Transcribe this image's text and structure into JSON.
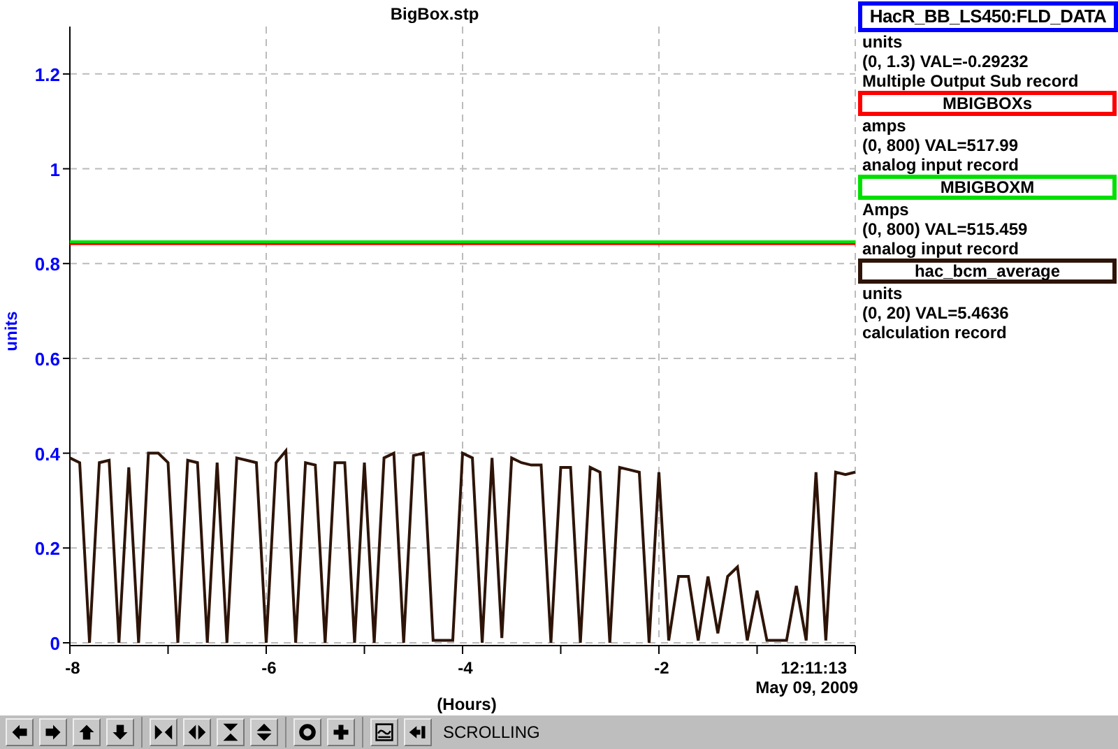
{
  "plot": {
    "title": "BigBox.stp",
    "timestamp_time": "12:11:13",
    "timestamp_date": "May 09, 2009",
    "chart_data": {
      "type": "line",
      "grid": true,
      "xlabel": "(Hours)",
      "ylabel": "units",
      "xlim": [
        -8,
        0
      ],
      "ylim": [
        0,
        1.3
      ],
      "xticks": [
        -8,
        -6,
        -4,
        -2
      ],
      "yticks": [
        {
          "value": 0,
          "label": "0"
        },
        {
          "value": 0.2,
          "label": "0.2"
        },
        {
          "value": 0.4,
          "label": "0.4"
        },
        {
          "value": 0.6,
          "label": "0.6"
        },
        {
          "value": 0.8,
          "label": "0.8"
        },
        {
          "value": 1,
          "label": "1"
        },
        {
          "value": 1.2,
          "label": "1.2"
        }
      ],
      "x": [
        -8.0,
        -7.9,
        -7.8,
        -7.7,
        -7.6,
        -7.5,
        -7.4,
        -7.3,
        -7.2,
        -7.1,
        -7.0,
        -6.9,
        -6.8,
        -6.7,
        -6.6,
        -6.5,
        -6.4,
        -6.3,
        -6.2,
        -6.1,
        -6.0,
        -5.9,
        -5.8,
        -5.7,
        -5.6,
        -5.5,
        -5.4,
        -5.3,
        -5.2,
        -5.1,
        -5.0,
        -4.9,
        -4.8,
        -4.7,
        -4.6,
        -4.5,
        -4.4,
        -4.3,
        -4.2,
        -4.1,
        -4.0,
        -3.9,
        -3.8,
        -3.7,
        -3.6,
        -3.5,
        -3.4,
        -3.3,
        -3.2,
        -3.1,
        -3.0,
        -2.9,
        -2.8,
        -2.7,
        -2.6,
        -2.5,
        -2.4,
        -2.3,
        -2.2,
        -2.1,
        -2.0,
        -1.9,
        -1.8,
        -1.7,
        -1.6,
        -1.5,
        -1.4,
        -1.3,
        -1.2,
        -1.1,
        -1.0,
        -0.9,
        -0.8,
        -0.7,
        -0.6,
        -0.5,
        -0.4,
        -0.3,
        -0.2,
        -0.1,
        0.0
      ],
      "series": [
        {
          "name": "MBIGBOXs",
          "color": "#ff0000",
          "values": [
            0.842,
            0.842,
            0.842,
            0.842,
            0.842,
            0.842,
            0.842,
            0.842,
            0.842,
            0.842,
            0.842,
            0.842,
            0.842,
            0.842,
            0.842,
            0.842,
            0.842,
            0.842,
            0.842,
            0.842,
            0.842,
            0.842,
            0.842,
            0.842,
            0.842,
            0.842,
            0.842,
            0.842,
            0.842,
            0.842,
            0.842,
            0.842,
            0.842,
            0.842,
            0.842,
            0.842,
            0.842,
            0.842,
            0.842,
            0.842,
            0.842,
            0.842,
            0.842,
            0.842,
            0.842,
            0.842,
            0.842,
            0.842,
            0.842,
            0.842,
            0.842,
            0.842,
            0.842,
            0.842,
            0.842,
            0.842,
            0.842,
            0.842,
            0.842,
            0.842,
            0.842,
            0.842,
            0.842,
            0.842,
            0.842,
            0.842,
            0.842,
            0.842,
            0.842,
            0.842,
            0.842,
            0.842,
            0.842,
            0.842,
            0.842,
            0.842,
            0.842,
            0.842,
            0.842,
            0.842,
            0.842
          ]
        },
        {
          "name": "MBIGBOXM",
          "color": "#00e000",
          "values": [
            0.846,
            0.846,
            0.846,
            0.846,
            0.846,
            0.846,
            0.846,
            0.846,
            0.846,
            0.846,
            0.846,
            0.846,
            0.846,
            0.846,
            0.846,
            0.846,
            0.846,
            0.846,
            0.846,
            0.846,
            0.846,
            0.846,
            0.846,
            0.846,
            0.846,
            0.846,
            0.846,
            0.846,
            0.846,
            0.846,
            0.846,
            0.846,
            0.846,
            0.846,
            0.846,
            0.846,
            0.846,
            0.846,
            0.846,
            0.846,
            0.846,
            0.846,
            0.846,
            0.846,
            0.846,
            0.846,
            0.846,
            0.846,
            0.846,
            0.846,
            0.846,
            0.846,
            0.846,
            0.846,
            0.846,
            0.846,
            0.846,
            0.846,
            0.846,
            0.846,
            0.846,
            0.846,
            0.846,
            0.846,
            0.846,
            0.846,
            0.846,
            0.846,
            0.846,
            0.846,
            0.846,
            0.846,
            0.846,
            0.846,
            0.846,
            0.846,
            0.846,
            0.846,
            0.846,
            0.846,
            0.846
          ]
        },
        {
          "name": "hac_bcm_average",
          "color": "#2e1408",
          "values": [
            0.39,
            0.38,
            0,
            0.38,
            0.385,
            0,
            0.37,
            0,
            0.4,
            0.4,
            0.38,
            0,
            0.385,
            0.38,
            0,
            0.38,
            0,
            0.39,
            0.385,
            0.38,
            0,
            0.38,
            0.405,
            0,
            0.38,
            0.375,
            0,
            0.38,
            0.38,
            0,
            0.38,
            0,
            0.39,
            0.4,
            0,
            0.395,
            0.4,
            0.005,
            0.005,
            0.005,
            0.4,
            0.39,
            0,
            0.39,
            0.01,
            0.39,
            0.38,
            0.375,
            0.375,
            0,
            0.37,
            0.37,
            0,
            0.37,
            0.36,
            0,
            0.37,
            0.365,
            0.36,
            0,
            0.36,
            0.005,
            0.14,
            0.14,
            0.005,
            0.14,
            0.02,
            0.14,
            0.16,
            0.005,
            0.11,
            0.005,
            0.005,
            0.005,
            0.12,
            0.005,
            0.36,
            0.005,
            0.36,
            0.355,
            0.36
          ]
        }
      ]
    }
  },
  "legend": [
    {
      "name": "HacR_BB_LS450:FLD_DATA",
      "color": "#0000ff",
      "units": "units",
      "reading": "(0, 1.3) VAL=-0.29232",
      "record": "Multiple Output Sub record"
    },
    {
      "units": "amps",
      "reading": "(0, 800) VAL=517.99",
      "record": "analog input record"
    },
    {
      "units": "Amps",
      "reading": "(0, 800) VAL=515.459",
      "record": "analog input record"
    },
    {
      "units": "units",
      "reading": "(0, 20) VAL=5.4636",
      "record": "calculation record"
    }
  ],
  "status": "SCROLLING"
}
